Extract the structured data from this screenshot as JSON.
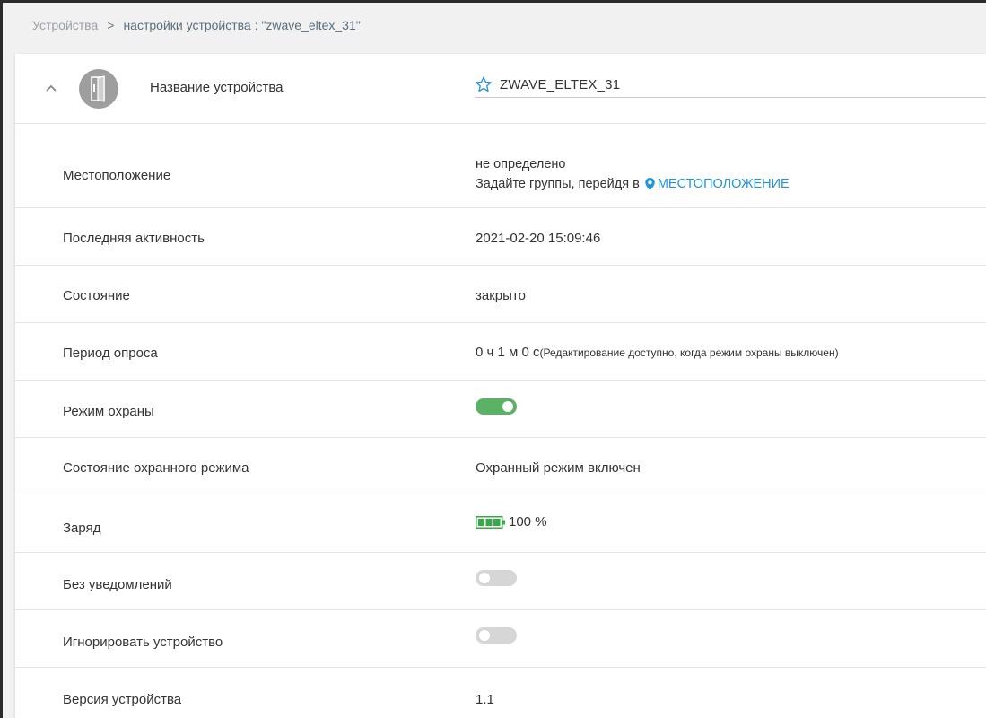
{
  "breadcrumb": {
    "root": "Устройства",
    "separator": ">",
    "current": "настройки устройства : \"zwave_eltex_31\""
  },
  "device": {
    "name_label": "Название устройства",
    "name_value": "ZWAVE_ELTEX_31",
    "icon": "door-sensor-icon"
  },
  "rows": [
    {
      "label": "Местоположение",
      "value": "не определено",
      "hint": "Задайте группы, перейдя в",
      "link": "МЕСТОПОЛОЖЕНИЕ",
      "link_icon": "map-marker-icon"
    },
    {
      "label": "Последняя активность",
      "value": "2021-02-20 15:09:46"
    },
    {
      "label": "Состояние",
      "value": "закрыто"
    },
    {
      "label": "Период опроса",
      "value": "0 ч 1 м 0 с",
      "note": "(Редактирование доступно, когда режим охраны выключен)"
    },
    {
      "label": "Режим охраны",
      "toggle": true
    },
    {
      "label": "Состояние охранного режима",
      "value": "Охранный режим включен"
    },
    {
      "label": "Заряд",
      "value": "100 %",
      "battery_level": 1.0
    },
    {
      "label": "Без уведомлений",
      "toggle": false
    },
    {
      "label": "Игнорировать устройство",
      "toggle": false
    },
    {
      "label": "Версия устройства",
      "value": "1.1"
    }
  ],
  "colors": {
    "accent": "#2196d8",
    "toggle_on": "#5bb267",
    "toggle_off": "#d6d6d6",
    "avatar": "#9e9e9e"
  }
}
